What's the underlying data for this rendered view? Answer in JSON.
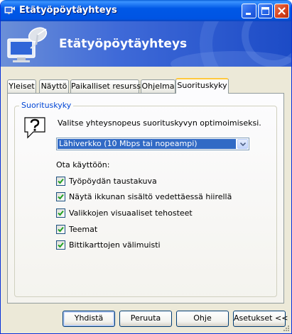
{
  "window": {
    "title": "Etätyöpöytäyhteys"
  },
  "banner": {
    "title": "Etätyöpöytäyhteys"
  },
  "tabs": [
    {
      "label": "Yleiset"
    },
    {
      "label": "Näyttö"
    },
    {
      "label": "Paikalliset resurssit"
    },
    {
      "label": "Ohjelma"
    },
    {
      "label": "Suorituskyky"
    }
  ],
  "performance": {
    "group_title": "Suorituskyky",
    "prompt": "Valitse yhteysnopeus suorituskyvyn optimoimiseksi.",
    "speed_selected": "Lähiverkko (10 Mbps tai nopeampi)",
    "allow_label": "Ota käyttöön:",
    "options": [
      {
        "label": "Työpöydän taustakuva",
        "checked": true
      },
      {
        "label": "Näytä ikkunan sisältö vedettäessä hiirellä",
        "checked": true
      },
      {
        "label": "Valikkojen visuaaliset tehosteet",
        "checked": true
      },
      {
        "label": "Teemat",
        "checked": true
      },
      {
        "label": "Bittikarttojen välimuisti",
        "checked": true
      }
    ]
  },
  "buttons": {
    "connect": "Yhdistä",
    "cancel": "Peruuta",
    "help": "Ohje",
    "options": "Asetukset <<"
  },
  "colors": {
    "titlebar": "#0054e3",
    "selection": "#316ac5",
    "group_title": "#0046d5",
    "active_tab_accent": "#ffc83c",
    "checkmark": "#21a121"
  }
}
